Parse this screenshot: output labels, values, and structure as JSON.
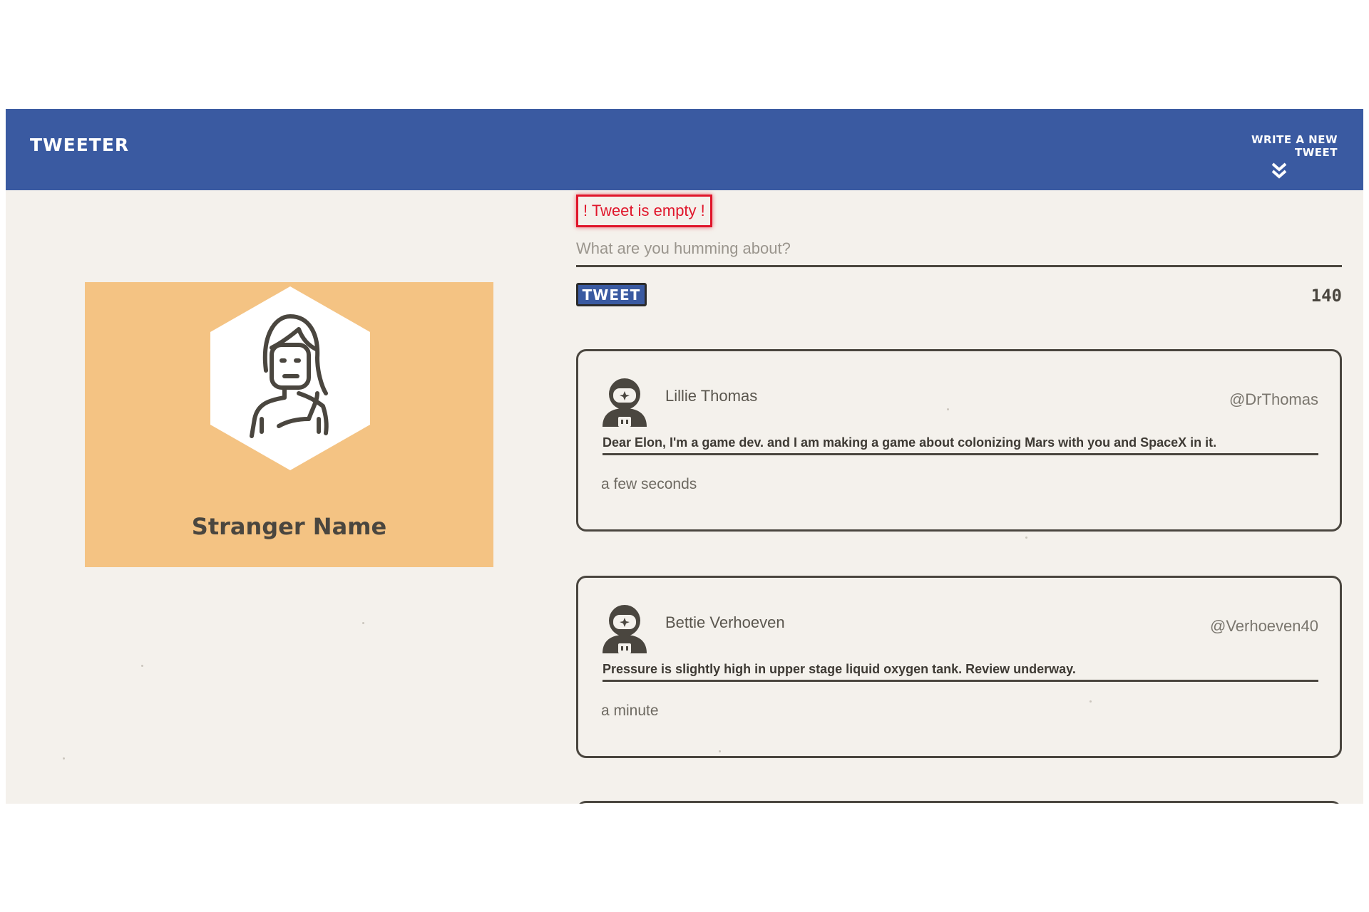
{
  "header": {
    "brand": "TWEETER",
    "compose_toggle_label": "WRITE A NEW TWEET",
    "compose_toggle_icon": "double-chevron-down-icon"
  },
  "profile": {
    "name": "Stranger Name",
    "avatar_icon": "woman-avatar-icon",
    "background_color": "#f4c383"
  },
  "compose": {
    "error_message": "! Tweet is empty !",
    "placeholder": "What are you humming about?",
    "value": "",
    "submit_label": "TWEET",
    "char_count": "140"
  },
  "tweets": [
    {
      "name": "Lillie Thomas",
      "handle": "@DrThomas",
      "content": "Dear Elon, I'm a game dev. and I am making a game about colonizing Mars with you and SpaceX in it.",
      "time": "a few seconds",
      "avatar_icon": "astronaut-avatar-icon"
    },
    {
      "name": "Bettie Verhoeven",
      "handle": "@Verhoeven40",
      "content": "Pressure is slightly high in upper stage liquid oxygen tank. Review underway.",
      "time": "a minute",
      "avatar_icon": "astronaut-avatar-icon"
    }
  ],
  "colors": {
    "nav_blue": "#3a5aa1",
    "page_bg": "#f4f1ec",
    "error_red": "#e0162b",
    "ink": "#4a463f"
  }
}
